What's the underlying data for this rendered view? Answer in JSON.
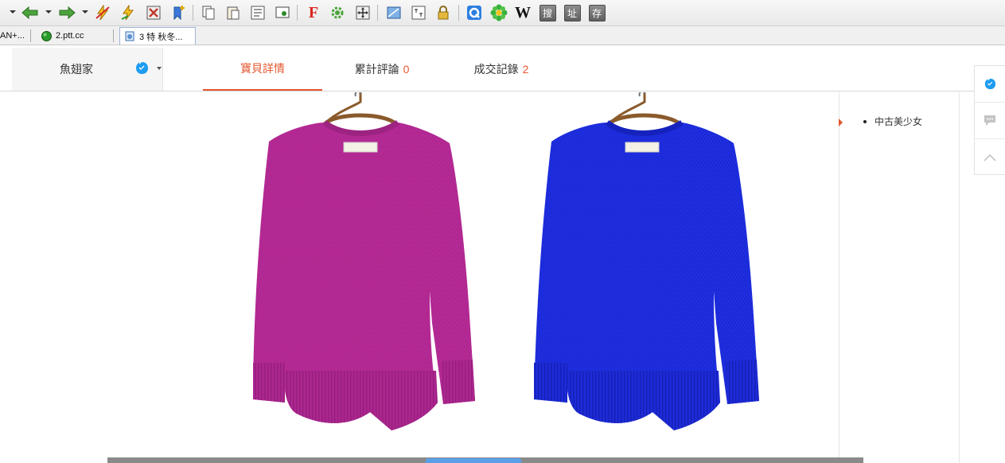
{
  "toolbar": {
    "buttons": [
      {
        "name": "back-arrow-icon",
        "color": "#3c8d2f"
      },
      {
        "name": "forward-arrow-icon",
        "color": "#3c8d2f"
      },
      {
        "name": "lightning-stop-icon",
        "color": "#e0a400"
      },
      {
        "name": "lightning-refresh-icon",
        "color": "#e0a400"
      },
      {
        "name": "close-page-icon",
        "color": "#c0392b"
      },
      {
        "name": "pin-add-icon",
        "color": "#2f6fc2"
      }
    ],
    "char_buttons": [
      "搜",
      "址",
      "存"
    ],
    "wiki_label": "W",
    "f_label": "F"
  },
  "tabs": [
    {
      "label": "AN+..."
    },
    {
      "label": "2.ptt.cc"
    },
    {
      "label": "3 特 秋冬..."
    }
  ],
  "shop": {
    "name": "魚翅家"
  },
  "nav": {
    "details_label": "寶貝詳情",
    "reviews_label": "累計評論",
    "reviews_count": "0",
    "records_label": "成交記錄",
    "records_count": "2"
  },
  "sidebar": {
    "items": [
      {
        "label": "中古美少女"
      }
    ]
  },
  "colors": {
    "accent": "#e4572e",
    "sweater_magenta": "#b72a98",
    "sweater_blue": "#1e2ee0"
  }
}
